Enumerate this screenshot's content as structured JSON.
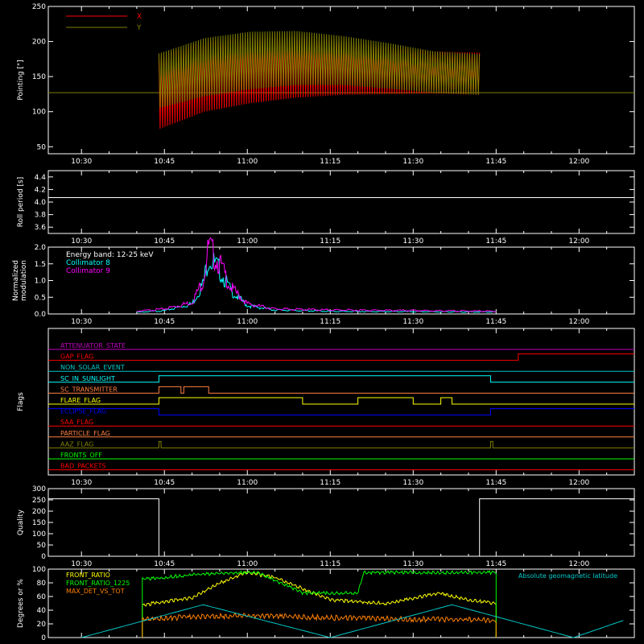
{
  "time_ticks": [
    "10:30",
    "10:45",
    "11:00",
    "11:15",
    "11:30",
    "11:45",
    "12:00"
  ],
  "chart_data": [
    {
      "type": "line",
      "ylabel": "Pointing [\"]",
      "ylim": [
        40,
        250
      ],
      "yticks": [
        50,
        100,
        150,
        200,
        250
      ],
      "xlabel": "",
      "legend_placement": "top-left",
      "series": [
        {
          "name": "X",
          "color": "#ff0000",
          "x_start": "10:44",
          "x_end": "11:42",
          "upper": [
            180,
            200,
            204,
            205,
            200,
            192,
            186,
            184
          ],
          "lower": [
            75,
            100,
            112,
            120,
            124,
            125,
            126,
            124
          ]
        },
        {
          "name": "Y",
          "color": "#808000",
          "x_start": "10:44",
          "x_end": "11:42",
          "upper": [
            183,
            205,
            214,
            215,
            208,
            198,
            186,
            182
          ],
          "lower": [
            105,
            122,
            132,
            138,
            138,
            133,
            127,
            124
          ]
        }
      ],
      "reference_line": {
        "value": 127,
        "color": "#808000"
      }
    },
    {
      "type": "line",
      "ylabel": "Roll period [s]",
      "ylim": [
        3.5,
        4.5
      ],
      "yticks": [
        "3.6",
        "3.8",
        "4.0",
        "4.2",
        "4.4"
      ],
      "series": [
        {
          "color": "#ffffff",
          "values_constant": 4.07
        }
      ]
    },
    {
      "type": "line",
      "ylabel": "Normalized modulation",
      "ylim": [
        0,
        2.0
      ],
      "yticks": [
        "0.0",
        "0.5",
        "1.0",
        "1.5",
        "2.0"
      ],
      "annotation": "Energy band: 12-25 keV",
      "series": [
        {
          "name": "Collimator 8",
          "color": "#00ffff",
          "x": [
            "10:40",
            "10:45",
            "10:50",
            "10:52",
            "10:53",
            "10:55",
            "10:57",
            "11:00",
            "11:05",
            "11:15",
            "11:30",
            "11:45"
          ],
          "y": [
            0.05,
            0.1,
            0.3,
            0.9,
            1.7,
            1.3,
            0.7,
            0.25,
            0.12,
            0.08,
            0.07,
            0.06
          ]
        },
        {
          "name": "Collimator 9",
          "color": "#ff00ff",
          "x": [
            "10:40",
            "10:45",
            "10:50",
            "10:52",
            "10:53",
            "10:55",
            "10:57",
            "11:00",
            "11:05",
            "11:15",
            "11:30",
            "11:45"
          ],
          "y": [
            0.08,
            0.15,
            0.35,
            1.0,
            2.0,
            1.5,
            0.8,
            0.3,
            0.15,
            0.12,
            0.1,
            0.08
          ]
        }
      ]
    },
    {
      "type": "line",
      "ylabel": "Flags",
      "flags": [
        {
          "name": "ATTENUATOR_STATE",
          "color": "#c000c0",
          "steps": [
            [
              "10:30",
              0
            ]
          ]
        },
        {
          "name": "GAP_FLAG",
          "color": "#ff0000",
          "steps": [
            [
              "10:30",
              0
            ],
            [
              "11:49",
              1
            ]
          ]
        },
        {
          "name": "NON_SOLAR_EVENT",
          "color": "#00c8c8",
          "steps": [
            [
              "10:30",
              0
            ]
          ]
        },
        {
          "name": "SC_IN_SUNLIGHT",
          "color": "#00ffff",
          "steps": [
            [
              "10:30",
              0
            ],
            [
              "10:44",
              1
            ],
            [
              "11:44",
              0
            ]
          ]
        },
        {
          "name": "SC_TRANSMITTER",
          "color": "#ff8040",
          "steps": [
            [
              "10:30",
              0
            ],
            [
              "10:44",
              1
            ],
            [
              "10:48",
              0
            ],
            [
              "10:48.5",
              1
            ],
            [
              "10:53",
              0
            ]
          ]
        },
        {
          "name": "FLARE_FLAG",
          "color": "#ffff00",
          "steps": [
            [
              "10:30",
              0
            ],
            [
              "10:44",
              1
            ],
            [
              "11:10",
              0
            ],
            [
              "11:20",
              1
            ],
            [
              "11:30",
              0
            ],
            [
              "11:35",
              1
            ],
            [
              "11:37",
              0
            ]
          ]
        },
        {
          "name": "ECLIPSE_FLAG",
          "color": "#0000ff",
          "steps": [
            [
              "10:30",
              1
            ],
            [
              "10:44",
              0
            ],
            [
              "11:44",
              1
            ]
          ]
        },
        {
          "name": "SAA_FLAG",
          "color": "#ff0000",
          "steps": [
            [
              "10:30",
              0
            ]
          ]
        },
        {
          "name": "PARTICLE_FLAG",
          "color": "#ff8040",
          "steps": [
            [
              "10:30",
              0
            ]
          ]
        },
        {
          "name": "AAZ_FLAG",
          "color": "#808000",
          "steps": [
            [
              "10:30",
              0
            ],
            [
              "10:44",
              1
            ],
            [
              "10:44.4",
              0
            ],
            [
              "11:44",
              1
            ],
            [
              "11:44.4",
              0
            ]
          ]
        },
        {
          "name": "FRONTS_OFF",
          "color": "#00ff00",
          "steps": [
            [
              "10:30",
              0
            ]
          ]
        },
        {
          "name": "BAD_PACKETS",
          "color": "#ff0000",
          "steps": [
            [
              "10:30",
              0
            ]
          ]
        }
      ]
    },
    {
      "type": "line",
      "ylabel": "Quality",
      "ylim": [
        0,
        300
      ],
      "yticks": [
        0,
        50,
        100,
        150,
        200,
        250,
        300
      ],
      "series": [
        {
          "color": "#ffffff",
          "steps": [
            [
              "10:30",
              255
            ],
            [
              "10:44",
              0
            ],
            [
              "11:42",
              255
            ]
          ]
        }
      ]
    },
    {
      "type": "line",
      "ylabel": "Degrees or %",
      "ylim": [
        0,
        100
      ],
      "yticks": [
        0,
        20,
        40,
        60,
        80,
        100
      ],
      "series": [
        {
          "name": "FRONT_RATIO",
          "color": "#ffff00",
          "x": [
            "10:41",
            "10:43",
            "10:50",
            "10:55",
            "11:00",
            "11:05",
            "11:15",
            "11:25",
            "11:35",
            "11:40",
            "11:45"
          ],
          "y": [
            47,
            50,
            58,
            80,
            95,
            88,
            55,
            50,
            65,
            55,
            50
          ]
        },
        {
          "name": "FRONT_RATIO_1225",
          "color": "#00ff00",
          "x": [
            "10:41",
            "10:50",
            "11:00",
            "11:02",
            "11:10",
            "11:20",
            "11:21",
            "11:30",
            "11:40",
            "11:45"
          ],
          "y": [
            85,
            92,
            95,
            95,
            65,
            65,
            95,
            95,
            95,
            95
          ]
        },
        {
          "name": "MAX_DET_VS_TOT",
          "color": "#ff8000",
          "x": [
            "10:41",
            "10:50",
            "11:00",
            "11:10",
            "11:20",
            "11:30",
            "11:40",
            "11:45"
          ],
          "y": [
            27,
            30,
            32,
            30,
            28,
            27,
            26,
            25
          ]
        },
        {
          "name": "Absolute geomagnetic latitude",
          "color": "#00c8c8",
          "x": [
            "10:30",
            "10:52",
            "11:15",
            "11:37",
            "11:59",
            "12:08"
          ],
          "y": [
            0,
            48,
            0,
            48,
            0,
            25
          ]
        }
      ]
    }
  ]
}
